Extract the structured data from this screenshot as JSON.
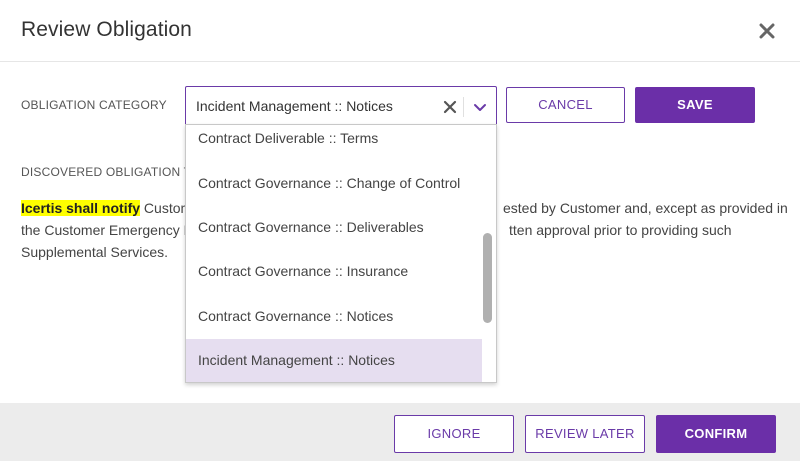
{
  "dialog": {
    "title": "Review Obligation",
    "close_icon": "close-icon"
  },
  "category": {
    "label": "OBLIGATION CATEGORY",
    "selected_value": "Incident Management :: Notices",
    "clear_icon": "clear-icon",
    "chevron_icon": "chevron-down-icon",
    "options": [
      "Contract Deliverable :: Terms",
      "Contract Governance :: Change of Control",
      "Contract Governance :: Deliverables",
      "Contract Governance :: Insurance",
      "Contract Governance :: Notices",
      "Incident Management :: Notices"
    ],
    "selected_index": 5
  },
  "buttons": {
    "cancel": "CANCEL",
    "save": "SAVE",
    "ignore": "IGNORE",
    "review_later": "REVIEW LATER",
    "confirm": "CONFIRM"
  },
  "discovered": {
    "label": "DISCOVERED OBLIGATION TE",
    "highlight": "Icertis shall notify",
    "line1_a": " Custom",
    "line1_b": "ested by Customer and, except as provided in",
    "line2_a": "the Customer Emergency F",
    "line2_b": "tten approval prior to providing such",
    "line3": "Supplemental Services."
  },
  "colors": {
    "accent": "#6b2fa8",
    "highlight": "#ffff00",
    "selected_option_bg": "#e6def0",
    "footer_bg": "#ececec"
  }
}
